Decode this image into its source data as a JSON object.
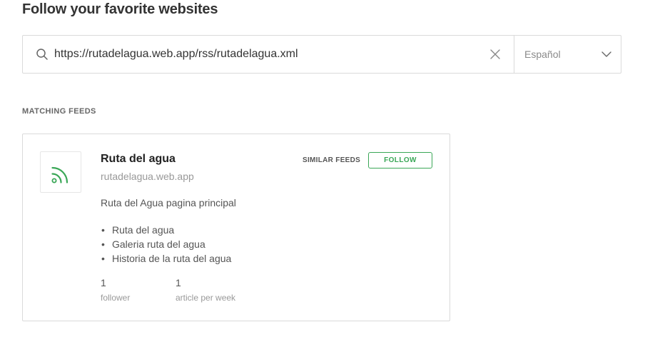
{
  "page": {
    "title": "Follow your favorite websites"
  },
  "search": {
    "value": "https://rutadelagua.web.app/rss/rutadelagua.xml",
    "language": "Español"
  },
  "results": {
    "heading": "MATCHING FEEDS",
    "feed": {
      "title": "Ruta del agua",
      "domain": "rutadelagua.web.app",
      "similar_label": "SIMILAR FEEDS",
      "follow_label": "FOLLOW",
      "description": "Ruta del Agua pagina principal",
      "articles": [
        "Ruta del agua",
        "Galeria ruta del agua",
        "Historia de la ruta del agua"
      ],
      "followers": {
        "value": "1",
        "label": "follower"
      },
      "frequency": {
        "value": "1",
        "label": "article per week"
      },
      "icon": "rss-icon",
      "accent_color": "#3aa757"
    }
  },
  "bullet": "•"
}
